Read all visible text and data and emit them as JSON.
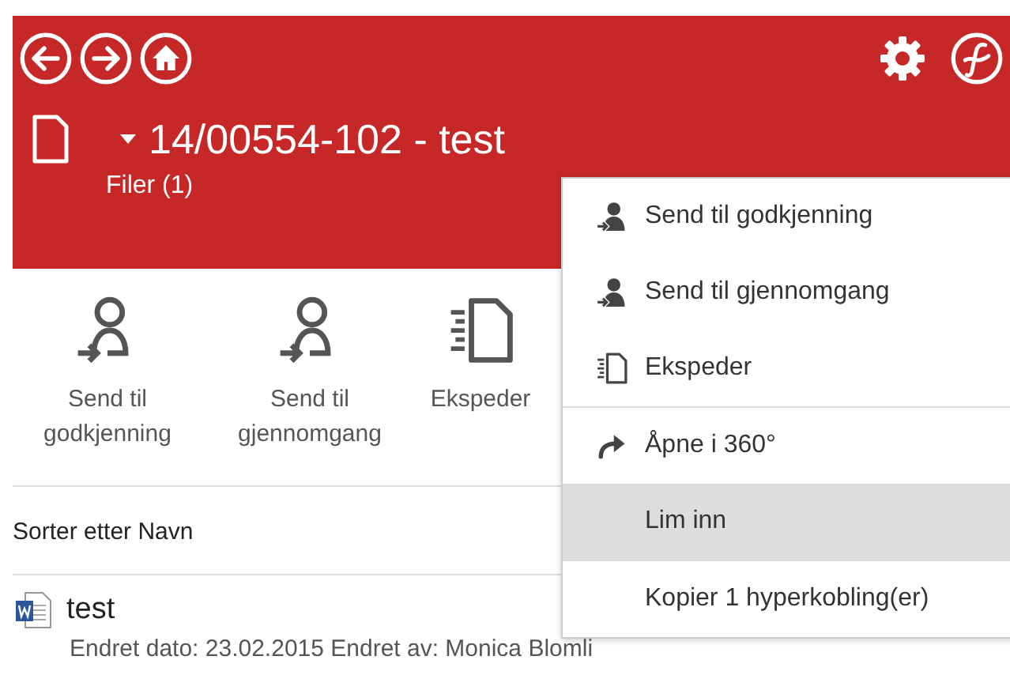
{
  "header": {
    "title": "14/00554-102 - test",
    "subtitle": "Filer (1)"
  },
  "toolbar": [
    {
      "kind": "person",
      "label": "Send til godkjenning"
    },
    {
      "kind": "person",
      "label": "Send til gjennomgang"
    },
    {
      "kind": "doc",
      "label": "Ekspeder"
    }
  ],
  "sort_label": "Sorter etter Navn",
  "files": [
    {
      "name": "test",
      "details": "Endret dato: 23.02.2015 Endret av: Monica Blomli"
    }
  ],
  "context_menu": {
    "groups": [
      [
        {
          "kind": "person",
          "label": "Send til godkjenning",
          "selected": false
        },
        {
          "kind": "person",
          "label": "Send til gjennomgang",
          "selected": false
        },
        {
          "kind": "doc",
          "label": "Ekspeder",
          "selected": false
        }
      ],
      [
        {
          "kind": "redo",
          "label": "Åpne i 360°",
          "selected": false
        },
        {
          "kind": "none",
          "label": "Lim inn",
          "selected": true
        }
      ],
      [
        {
          "kind": "none",
          "label": "Kopier 1 hyperkobling(er)",
          "selected": false
        }
      ]
    ]
  }
}
